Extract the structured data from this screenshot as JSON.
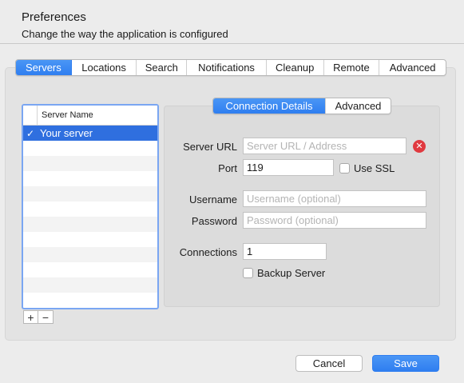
{
  "header": {
    "title": "Preferences",
    "subtitle": "Change the way the application is configured"
  },
  "tabs": [
    {
      "label": "Servers",
      "active": true
    },
    {
      "label": "Locations",
      "active": false
    },
    {
      "label": "Search",
      "active": false
    },
    {
      "label": "Notifications",
      "active": false
    },
    {
      "label": "Cleanup",
      "active": false
    },
    {
      "label": "Remote",
      "active": false
    },
    {
      "label": "Advanced",
      "active": false
    }
  ],
  "server_list": {
    "column_header": "Server Name",
    "rows": [
      {
        "checked": true,
        "name": "Your server",
        "selected": true
      }
    ],
    "check_glyph": "✓"
  },
  "list_buttons": {
    "add": "+",
    "remove": "−"
  },
  "detail_tabs": {
    "connection_details": "Connection Details",
    "advanced": "Advanced"
  },
  "form": {
    "server_url": {
      "label": "Server URL",
      "value": "",
      "placeholder": "Server URL / Address"
    },
    "port": {
      "label": "Port",
      "value": "119"
    },
    "use_ssl": {
      "label": "Use SSL",
      "checked": false
    },
    "username": {
      "label": "Username",
      "value": "",
      "placeholder": "Username (optional)"
    },
    "password": {
      "label": "Password",
      "value": "",
      "placeholder": "Password (optional)"
    },
    "connections": {
      "label": "Connections",
      "value": "1"
    },
    "backup_server": {
      "label": "Backup Server",
      "checked": false
    }
  },
  "icons": {
    "clear": "clear-icon",
    "clear_glyph": "✕"
  },
  "buttons": {
    "cancel": "Cancel",
    "save": "Save"
  },
  "colors": {
    "accent": "#2f7ef0",
    "selection": "#2f6fdf",
    "error": "#e0393f"
  }
}
